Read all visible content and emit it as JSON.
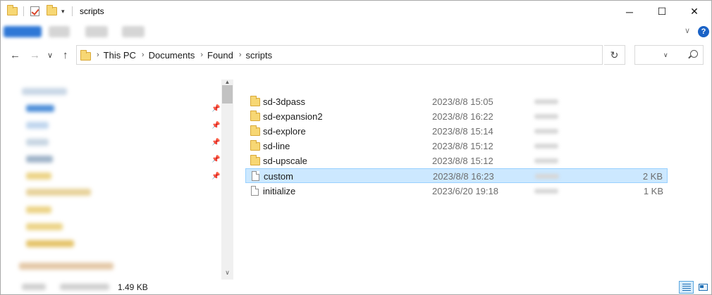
{
  "window": {
    "title": "scripts",
    "minimize_glyph": "─",
    "maximize_glyph": "☐",
    "close_glyph": "✕"
  },
  "ribbon": {
    "help_glyph": "?",
    "collapse_glyph": "∨"
  },
  "nav": {
    "back_glyph": "←",
    "forward_glyph": "→",
    "recent_glyph": "∨",
    "up_glyph": "↑",
    "refresh_glyph": "↻"
  },
  "address": {
    "crumbs": [
      "This PC",
      "Documents",
      "Found",
      "scripts"
    ],
    "separator": "›",
    "dropdown_glyph": "∨"
  },
  "search": {
    "placeholder": ""
  },
  "files": [
    {
      "name": "sd-3dpass",
      "date": "2023/8/8 15:05",
      "size": "",
      "kind": "folder"
    },
    {
      "name": "sd-expansion2",
      "date": "2023/8/8 16:22",
      "size": "",
      "kind": "folder"
    },
    {
      "name": "sd-explore",
      "date": "2023/8/8 15:14",
      "size": "",
      "kind": "folder"
    },
    {
      "name": "sd-line",
      "date": "2023/8/8 15:12",
      "size": "",
      "kind": "folder"
    },
    {
      "name": "sd-upscale",
      "date": "2023/8/8 15:12",
      "size": "",
      "kind": "folder"
    },
    {
      "name": "custom",
      "date": "2023/8/8 16:23",
      "size": "2 KB",
      "kind": "file",
      "selected": true
    },
    {
      "name": "initialize",
      "date": "2023/6/20 19:18",
      "size": "1 KB",
      "kind": "file"
    }
  ],
  "navpane": {
    "scroll_up_glyph": "▲",
    "scroll_down_glyph": "∨",
    "pin_glyph": "📌"
  },
  "status": {
    "selected_size": "1.49 KB"
  },
  "colors": {
    "selection_bg": "#cce8ff",
    "selection_border": "#99d1ff",
    "folder_yellow": "#f7d774",
    "help_blue": "#1a62c6"
  }
}
